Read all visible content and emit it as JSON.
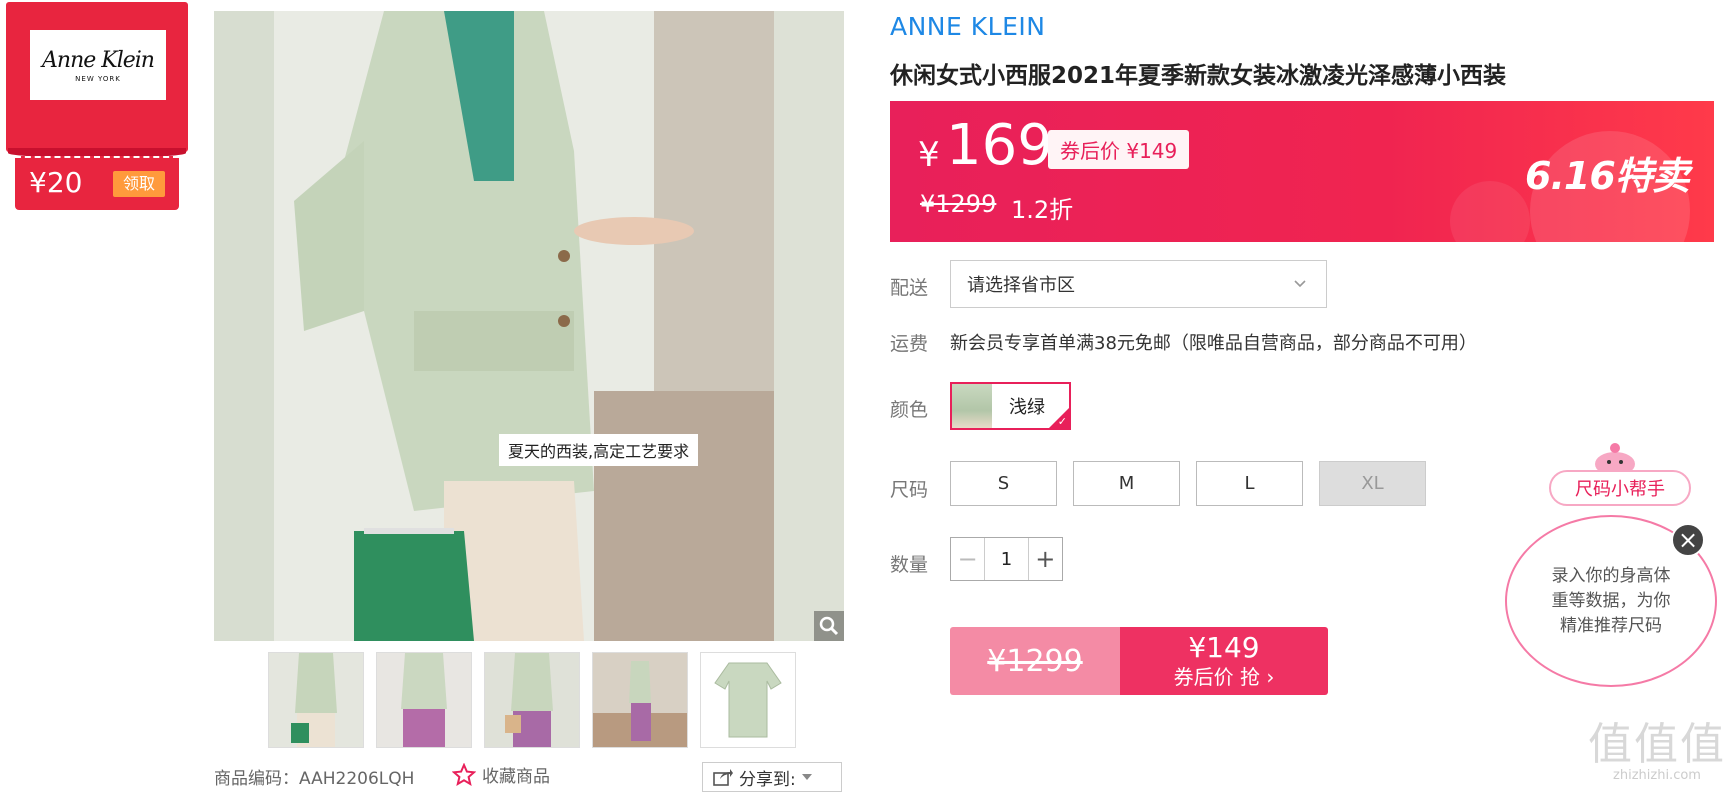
{
  "coupon": {
    "amount": "¥20",
    "claim_label": "领取",
    "logo_text": "Anne Klein",
    "logo_sub": "NEW YORK"
  },
  "gallery": {
    "caption": "夏天的西装,高定工艺要求",
    "thumbnail_count": 5
  },
  "footer": {
    "sku": "商品编码：AAH2206LQH",
    "favorite_label": "收藏商品",
    "share_label": "分享到:"
  },
  "product": {
    "brand": "ANNE KLEIN",
    "title": "休闲女式小西服2021年夏季新款女装冰激凌光泽感薄小西装"
  },
  "price": {
    "currency": "¥",
    "current": "169",
    "after_coupon": "券后价 ¥149",
    "original": "¥1299",
    "discount": "1.2折",
    "event": "6.16特卖"
  },
  "shipping": {
    "label": "配送",
    "placeholder": "请选择省市区",
    "fee_label": "运费",
    "fee_text": "新会员专享首单满38元免邮（限唯品自营商品，部分商品不可用）"
  },
  "color": {
    "label": "颜色",
    "options": [
      "浅绿"
    ]
  },
  "size": {
    "label": "尺码",
    "options": [
      {
        "name": "S",
        "available": true
      },
      {
        "name": "M",
        "available": true
      },
      {
        "name": "L",
        "available": true
      },
      {
        "name": "XL",
        "available": false
      }
    ]
  },
  "quantity": {
    "label": "数量",
    "value": "1",
    "minus": "−",
    "plus": "+"
  },
  "buy": {
    "original": "¥1299",
    "price": "¥149",
    "action": "券后价 抢 ›"
  },
  "size_helper": {
    "title": "尺码小帮手",
    "line1": "录入你的身高体",
    "line2": "重等数据，为你",
    "line3": "精准推荐尺码"
  },
  "watermark": {
    "big": "值值值",
    "small": "zhizhizhi.com"
  },
  "colors": {
    "accent": "#e8205a",
    "brand_blue": "#1e88e5",
    "coupon_red": "#e8253f"
  }
}
